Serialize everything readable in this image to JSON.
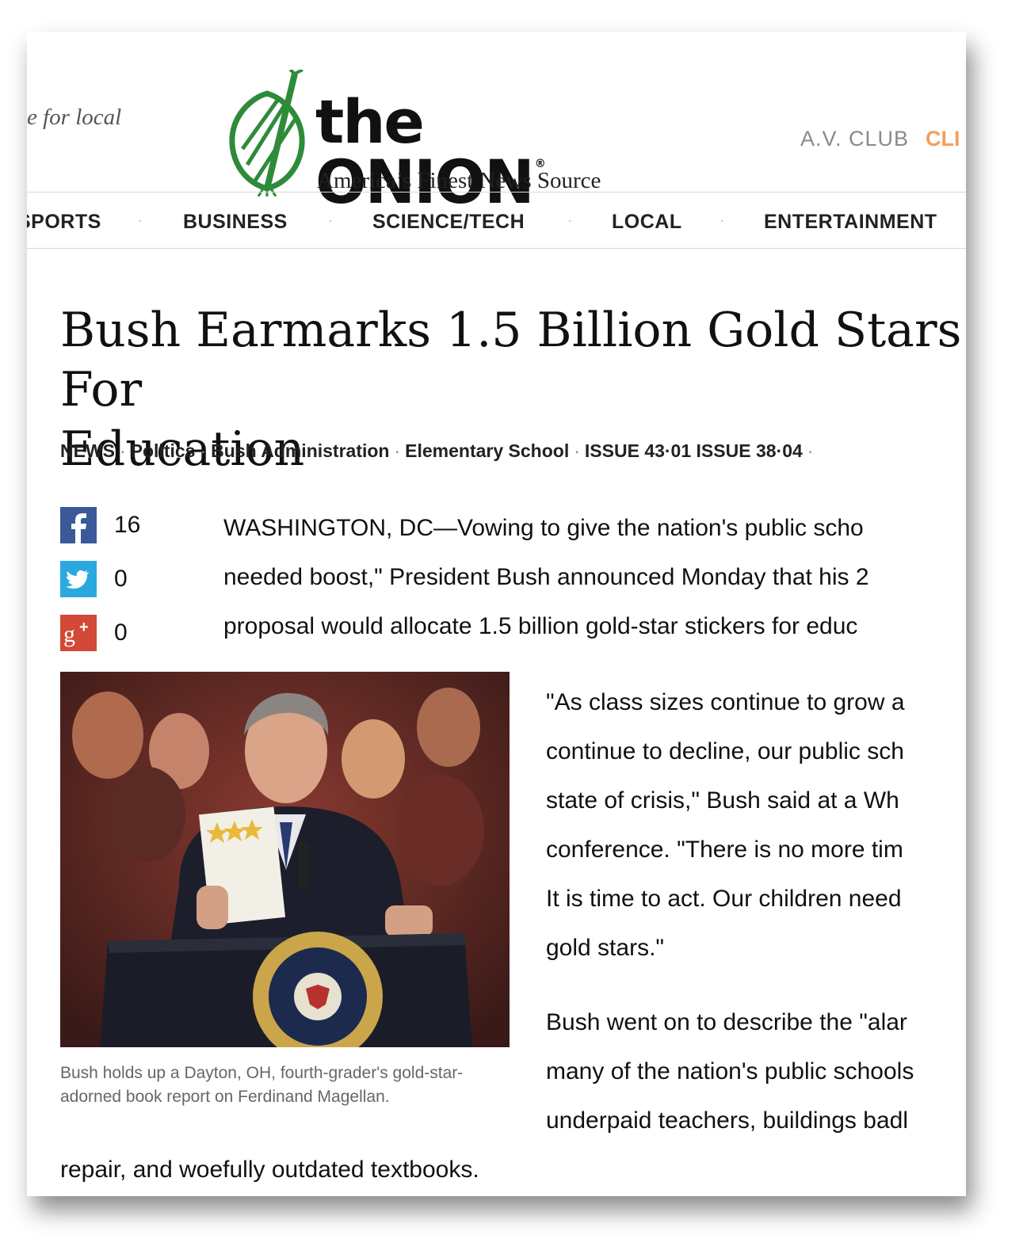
{
  "header": {
    "local_tagline": "e for local",
    "logo_title": "the ONION",
    "logo_registered": "®",
    "logo_subtitle": "America’s Finest News Source",
    "av_club": "A.V. CLUB",
    "click": "CLI"
  },
  "nav": {
    "items": [
      "SPORTS",
      "BUSINESS",
      "SCIENCE/TECH",
      "LOCAL",
      "ENTERTAINMENT"
    ],
    "separator": "·"
  },
  "article": {
    "headline_line1": "Bush Earmarks 1.5 Billion Gold Stars For",
    "headline_line2": "Education",
    "tags": [
      "NEWS",
      "Politics",
      "Bush Administration",
      "Elementary School",
      "ISSUE 43·01 ISSUE 38·04"
    ],
    "tag_separator": "·",
    "share": {
      "facebook_count": "16",
      "twitter_count": "0",
      "googleplus_count": "0"
    },
    "lede_lines": [
      "WASHINGTON, DC—Vowing to give the nation's public scho",
      "needed boost,\" President Bush announced Monday that his 2",
      "proposal would allocate 1.5 billion gold-star stickers for educ"
    ],
    "para2_lines": [
      "\"As class sizes continue to grow a",
      "continue to decline, our public sch",
      "state of crisis,\" Bush said at a Wh",
      "conference. \"There is no more tim",
      "It is time to act. Our children need",
      "gold stars.\""
    ],
    "para3_lines": [
      "Bush went on to describe the \"alar",
      "many of the nation's public schools",
      "underpaid teachers, buildings badl"
    ],
    "last_line": "repair, and woefully outdated textbooks.",
    "photo_caption": "Bush holds up a Dayton, OH, fourth-grader's gold-star-adorned book report on Ferdinand Magellan."
  },
  "colors": {
    "onion_green": "#2e8b3a",
    "facebook": "#3b5998",
    "twitter": "#2aa9e0",
    "googleplus": "#d34836",
    "click_orange": "#f0a060"
  },
  "icons": [
    "onion-logo-icon",
    "facebook-icon",
    "twitter-icon",
    "google-plus-icon",
    "presidential-seal"
  ]
}
